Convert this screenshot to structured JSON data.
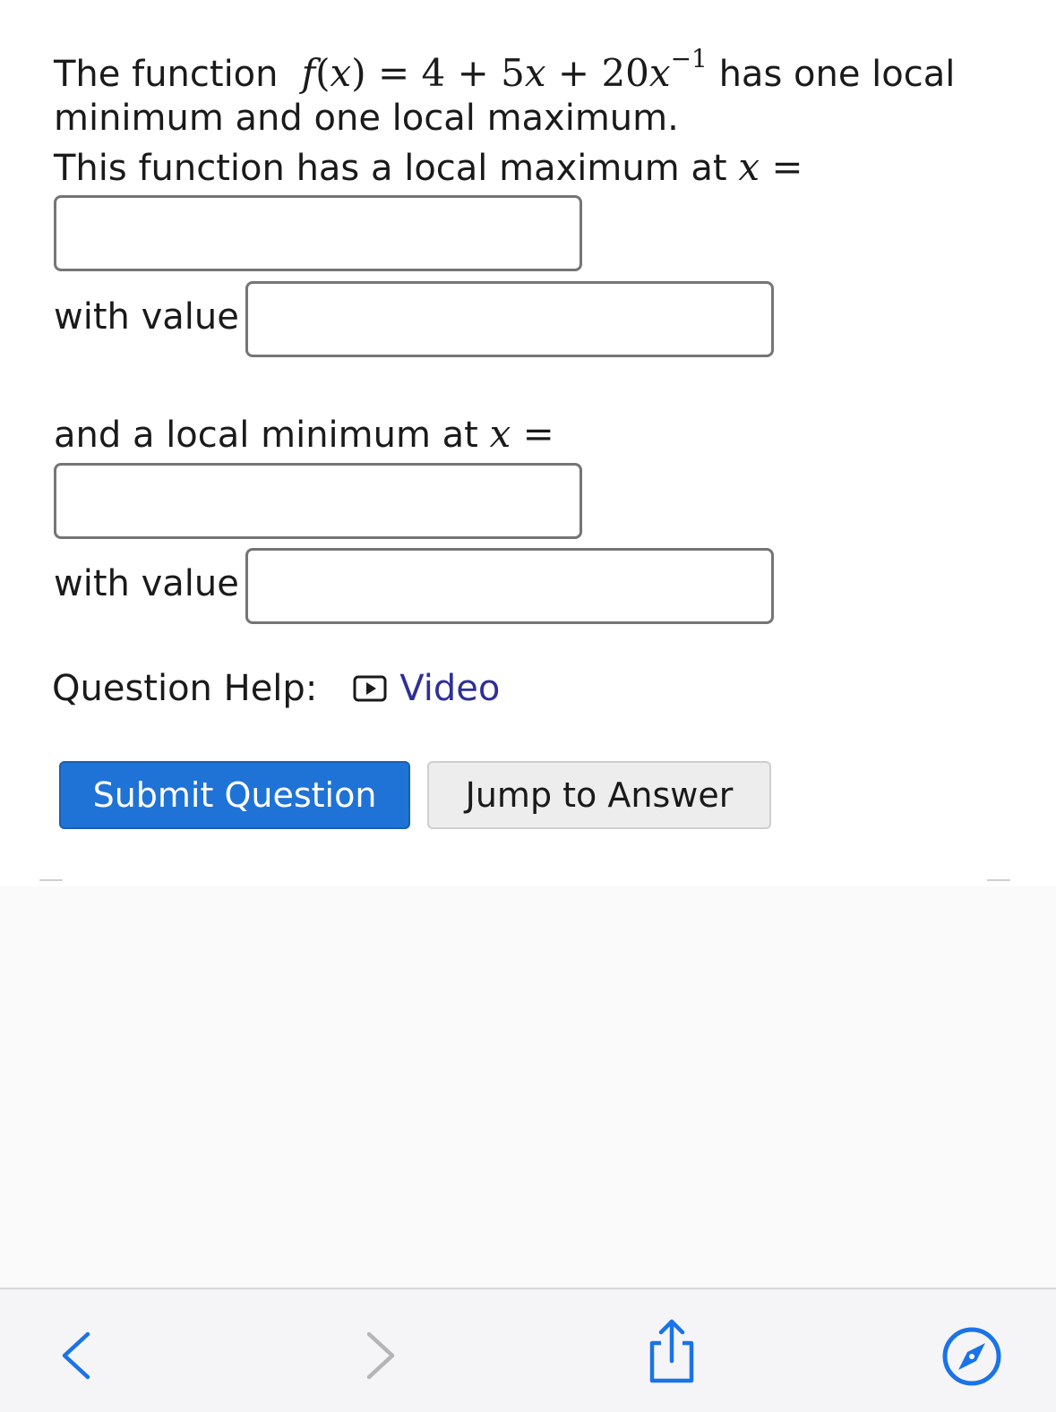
{
  "question": {
    "intro_prefix": "The function",
    "formula": {
      "f": "f",
      "x": "x",
      "equals_rhs": "= 4 + 5",
      "plus_20": " + 20",
      "exponent": "−1"
    },
    "intro_suffix": "has one local",
    "line2": "minimum and one local maximum.",
    "line3_prefix": "This function has a local maximum at",
    "line3_var": "x",
    "equals": "=",
    "with_value_label_1": "with value",
    "min_prefix": "and a local minimum at",
    "min_var": "x",
    "with_value_label_2": "with value"
  },
  "inputs": {
    "max_x": "",
    "max_value": "",
    "min_x": "",
    "min_value": ""
  },
  "help": {
    "label": "Question Help:",
    "video_label": "Video",
    "video_icon": "play-icon",
    "link_color": "#2f2f9a"
  },
  "buttons": {
    "submit_label": "Submit Question",
    "jump_label": "Jump to Answer",
    "submit_color": "#1f73d6"
  },
  "toolbar": {
    "icons": [
      "back-icon",
      "forward-icon",
      "share-icon",
      "compass-icon"
    ],
    "accent": "#1a73e8"
  }
}
